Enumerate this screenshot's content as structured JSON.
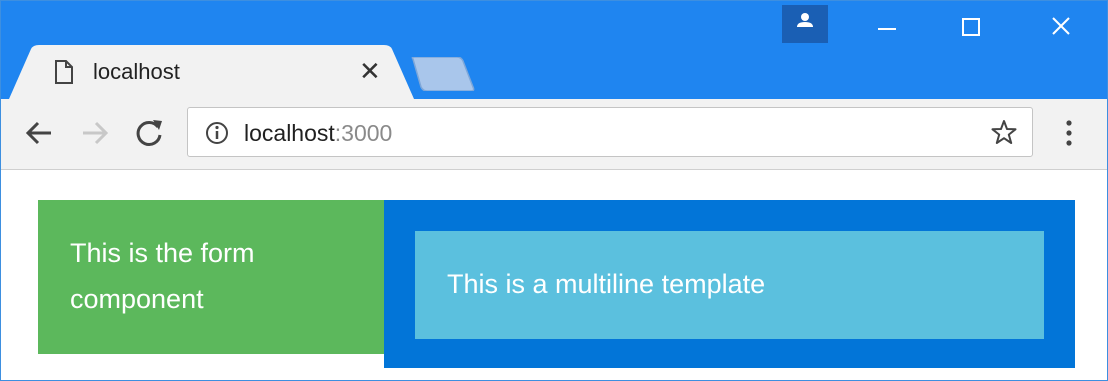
{
  "browser": {
    "tab": {
      "title": "localhost",
      "close_glyph": "✕",
      "icon": "page-icon"
    },
    "new_tab_icon": "new-tab-icon",
    "profile_icon": "person-icon",
    "window_controls": [
      "minimize-icon",
      "maximize-icon",
      "close-icon"
    ],
    "colors": {
      "titlebar": "#1f85f0",
      "toolbar": "#f2f2f2"
    }
  },
  "toolbar": {
    "back_icon": "arrow-left-icon",
    "forward_icon": "arrow-right-icon",
    "reload_icon": "reload-icon",
    "address": {
      "host": "localhost",
      "port": ":3000"
    },
    "info_icon": "info-icon",
    "bookmark_icon": "star-icon",
    "menu_icon": "more-vert-icon"
  },
  "page": {
    "form_component_text": "This is the form component",
    "template_text": "This is a multiline template",
    "colors": {
      "form_bg": "#5cb85c",
      "outer_bg": "#0275d8",
      "inner_bg": "#5bc0de"
    }
  }
}
